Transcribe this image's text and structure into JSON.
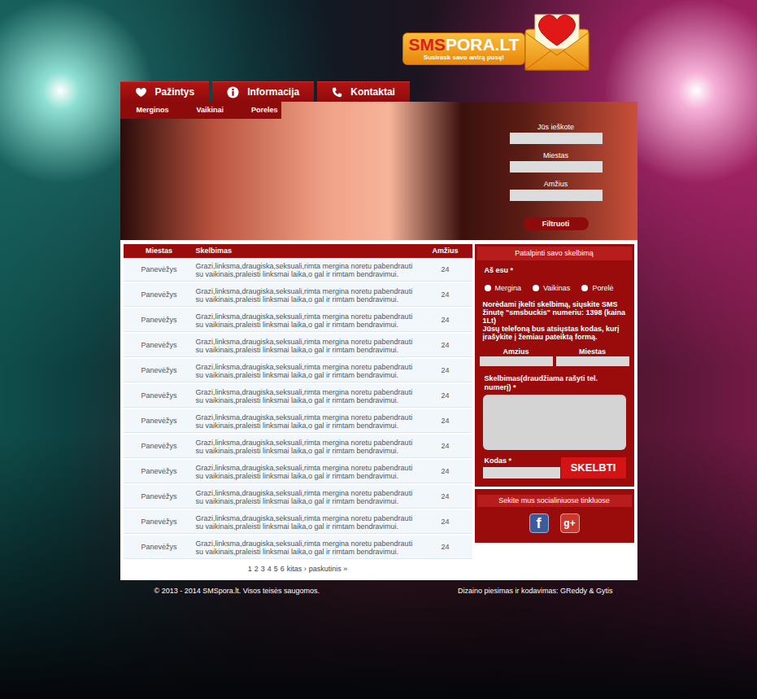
{
  "logo": {
    "part1": "SMS",
    "part2": "PORA.LT",
    "tagline": "Susirask savo antrą pusę!"
  },
  "nav": [
    {
      "label": "Pažintys",
      "kind": "heart"
    },
    {
      "label": "Informacija",
      "kind": "info"
    },
    {
      "label": "Kontaktai",
      "kind": "phone"
    }
  ],
  "subnav": [
    "Merginos",
    "Vaikinai",
    "Poreles"
  ],
  "filter": {
    "fields": [
      "Jūs ieškote",
      "Miestas",
      "Amžius"
    ],
    "button": "Filtruoti"
  },
  "table": {
    "columns": [
      "Miestas",
      "Skelbimas",
      "Amžius"
    ],
    "rows": [
      [
        "Panevėžys",
        "Grazi,linksma,draugiska,seksuali,rimta mergina noretu pabendrauti su vaikinais,praleisti linksmai laika,o gal ir rimtam bendravimui.",
        "24"
      ],
      [
        "Panevėžys",
        "Grazi,linksma,draugiska,seksuali,rimta mergina noretu pabendrauti su vaikinais,praleisti linksmai laika,o gal ir rimtam bendravimui.",
        "24"
      ],
      [
        "Panevėžys",
        "Grazi,linksma,draugiska,seksuali,rimta mergina noretu pabendrauti su vaikinais,praleisti linksmai laika,o gal ir rimtam bendravimui.",
        "24"
      ],
      [
        "Panevėžys",
        "Grazi,linksma,draugiska,seksuali,rimta mergina noretu pabendrauti su vaikinais,praleisti linksmai laika,o gal ir rimtam bendravimui.",
        "24"
      ],
      [
        "Panevėžys",
        "Grazi,linksma,draugiska,seksuali,rimta mergina noretu pabendrauti su vaikinais,praleisti linksmai laika,o gal ir rimtam bendravimui.",
        "24"
      ],
      [
        "Panevėžys",
        "Grazi,linksma,draugiska,seksuali,rimta mergina noretu pabendrauti su vaikinais,praleisti linksmai laika,o gal ir rimtam bendravimui.",
        "24"
      ],
      [
        "Panevėžys",
        "Grazi,linksma,draugiska,seksuali,rimta mergina noretu pabendrauti su vaikinais,praleisti linksmai laika,o gal ir rimtam bendravimui.",
        "24"
      ],
      [
        "Panevėžys",
        "Grazi,linksma,draugiska,seksuali,rimta mergina noretu pabendrauti su vaikinais,praleisti linksmai laika,o gal ir rimtam bendravimui.",
        "24"
      ],
      [
        "Panevėžys",
        "Grazi,linksma,draugiska,seksuali,rimta mergina noretu pabendrauti su vaikinais,praleisti linksmai laika,o gal ir rimtam bendravimui.",
        "24"
      ],
      [
        "Panevėžys",
        "Grazi,linksma,draugiska,seksuali,rimta mergina noretu pabendrauti su vaikinais,praleisti linksmai laika,o gal ir rimtam bendravimui.",
        "24"
      ],
      [
        "Panevėžys",
        "Grazi,linksma,draugiska,seksuali,rimta mergina noretu pabendrauti su vaikinais,praleisti linksmai laika,o gal ir rimtam bendravimui.",
        "24"
      ],
      [
        "Panevėžys",
        "Grazi,linksma,draugiska,seksuali,rimta mergina noretu pabendrauti su vaikinais,praleisti linksmai laika,o gal ir rimtam bendravimui.",
        "24"
      ]
    ]
  },
  "pagination": {
    "pages": [
      "1",
      "2",
      "3",
      "4",
      "5",
      "6"
    ],
    "next": "kitas ›",
    "last": "paskutinis »"
  },
  "post_form": {
    "title": "Patalpinti savo skelbimą",
    "who_label": "Aš esu *",
    "who_options": [
      {
        "label": "Mergina",
        "selected": false
      },
      {
        "label": "Vaikinas",
        "selected": false
      },
      {
        "label": "Porelė",
        "selected": false
      }
    ],
    "sms_info": "Norėdami įkelti skelbimą, siųskite SMS žinutę \"smsbuckis\" numeriu: 1398 (kaina 1Lt)",
    "code_info": "Jūsų telefoną bus atsiųstas kodas, kurį įrašykite į žemiau pateiktą formą.",
    "age_label": "Amzius",
    "city_label": "Miestas",
    "ad_label": "Skelbimas(draudžiama rašyti tel. numerį) *",
    "code_label": "Kodas *",
    "submit": "SKELBTI"
  },
  "social": {
    "title": "Sekite mus socialiniuose tinkluose",
    "links": [
      {
        "kind": "facebook",
        "glyph": "f"
      },
      {
        "kind": "google",
        "glyph": "g+"
      }
    ]
  },
  "footer": {
    "copyright": "© 2013 - 2014 SMSpora.lt. Visos teisės saugomos.",
    "credits": "Dizaino piesimas ir kodavimas: GReddy & Gytis"
  }
}
